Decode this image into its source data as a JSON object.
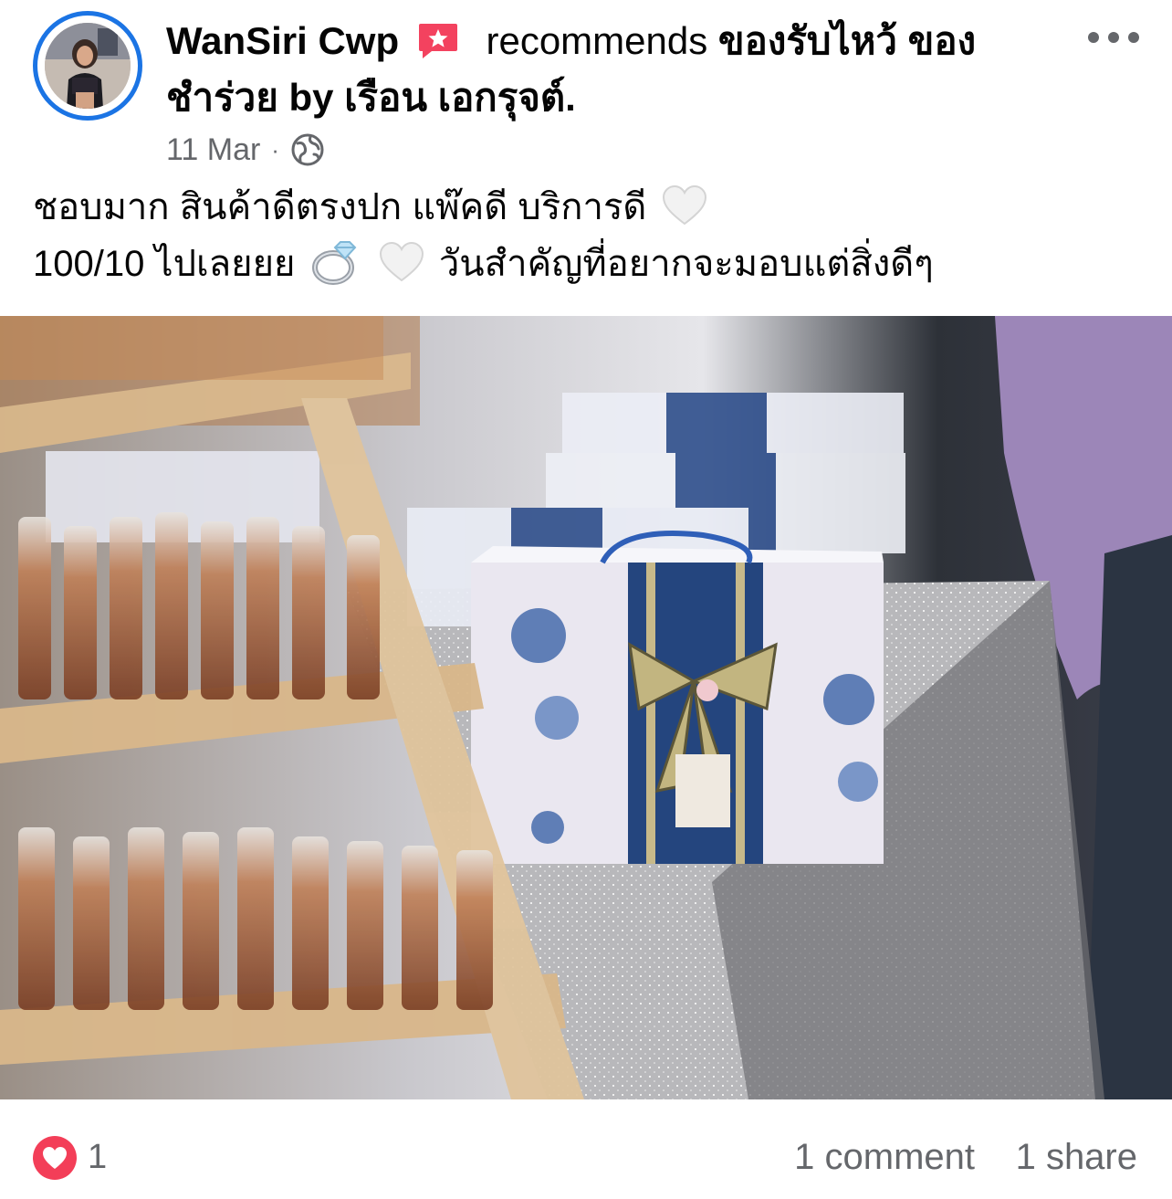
{
  "post": {
    "author": "WanSiri Cwp",
    "action": "recommends",
    "page_name": "ของรับไหว้ ของชำร่วย by เรือน เอกรุจต์.",
    "date": "11 Mar",
    "separator": "·",
    "privacy_icon": "globe-icon",
    "badge_icon": "recommend-star-icon",
    "text_line_1": "ชอบมาก สินค้าดีตรงปก แพ๊คดี บริการดี",
    "text_line_2_a": "100/10 ไปเลยยย",
    "text_line_2_b": "วันสำคัญที่อยากจะมอบแต่สิ่งดีๆ",
    "emojis": [
      "white-heart",
      "ring",
      "white-heart"
    ]
  },
  "photo": {
    "subject": "gift-boxes-and-bottles-photo"
  },
  "footer": {
    "reaction_icon": "heart-reaction-icon",
    "reaction_count": "1",
    "comments": "1 comment",
    "shares": "1 share"
  },
  "colors": {
    "accent": "#1b74e4",
    "secondary_text": "#65676b",
    "heart": "#f33e58",
    "badge": "#f3425f"
  }
}
